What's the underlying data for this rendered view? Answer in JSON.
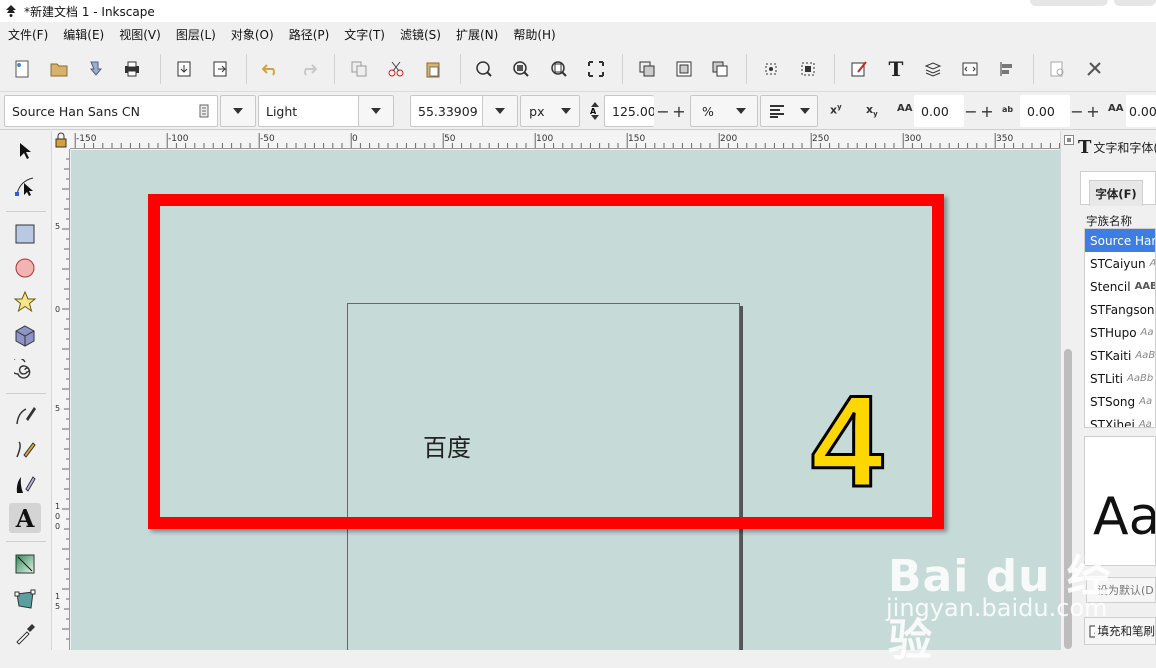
{
  "window": {
    "title": "*新建文档 1 - Inkscape"
  },
  "menu": [
    "文件(F)",
    "编辑(E)",
    "视图(V)",
    "图层(L)",
    "对象(O)",
    "路径(P)",
    "文字(T)",
    "滤镜(S)",
    "扩展(N)",
    "帮助(H)"
  ],
  "textbar": {
    "font_family": "Source Han Sans CN",
    "font_style": "Light",
    "font_size": "55.33909",
    "unit": "px",
    "line_spacing": "125.00",
    "spacing_unit": "%",
    "letter_spacing": "0.00",
    "word_spacing": "0.00",
    "kerning": "0.00",
    "labels": {
      "superscript": "x",
      "subscript": "x",
      "letter": "AA",
      "word": "ab",
      "kern": "AA"
    }
  },
  "ruler": {
    "h_ticks": [
      "-150",
      "-100",
      "-50",
      "0",
      "50",
      "100",
      "150",
      "200",
      "250",
      "300",
      "350"
    ],
    "v_ticks": [
      "5",
      "0",
      "5",
      "1 0 0",
      "1 5"
    ]
  },
  "canvas": {
    "text": "百度",
    "annotation_number": "4"
  },
  "panel": {
    "title": "文字和字体(",
    "tab_font": "字体(F)",
    "family_label": "字族名称",
    "families": [
      {
        "name": "Source Han",
        "sample": ""
      },
      {
        "name": "STCaiyun",
        "sample": "A"
      },
      {
        "name": "Stencil",
        "sample": "AAB"
      },
      {
        "name": "STFangsong",
        "sample": ""
      },
      {
        "name": "STHupo",
        "sample": "Aa"
      },
      {
        "name": "STKaiti",
        "sample": "AaB"
      },
      {
        "name": "STLiti",
        "sample": "AaBb"
      },
      {
        "name": "STSong",
        "sample": "Aa"
      },
      {
        "name": "STXihei",
        "sample": "Aa"
      }
    ],
    "preview": "Aa",
    "set_default": "设为默认(D",
    "fill_stroke": "填充和笔刷"
  },
  "watermark": {
    "brand": "Bai du 经验",
    "url": "jingyan.baidu.com"
  },
  "colors": {
    "annotation": "#ff0000",
    "number": "#ffd700",
    "canvas": "#c6dad8",
    "selection": "#3d7ee0"
  }
}
